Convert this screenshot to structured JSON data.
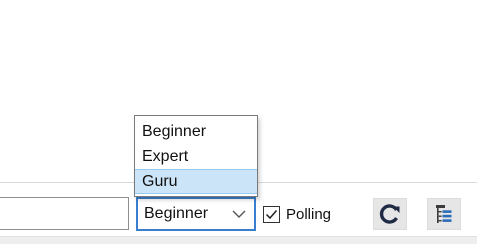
{
  "toolbar": {
    "filter_input": {
      "value": "",
      "placeholder": ""
    },
    "level_select": {
      "selected": "Beginner",
      "options": [
        "Beginner",
        "Expert",
        "Guru"
      ],
      "highlighted_option": "Guru"
    },
    "polling": {
      "label": "Polling",
      "checked": true
    },
    "refresh_button_icon": "refresh-icon",
    "tree_view_button_icon": "tree-list-icon"
  },
  "colors": {
    "select_focus_border": "#3a7fcf",
    "option_highlight": "#cce4f7",
    "refresh_icon": "#1f2a44",
    "tree_icon_lines": "#2b6cb8"
  }
}
